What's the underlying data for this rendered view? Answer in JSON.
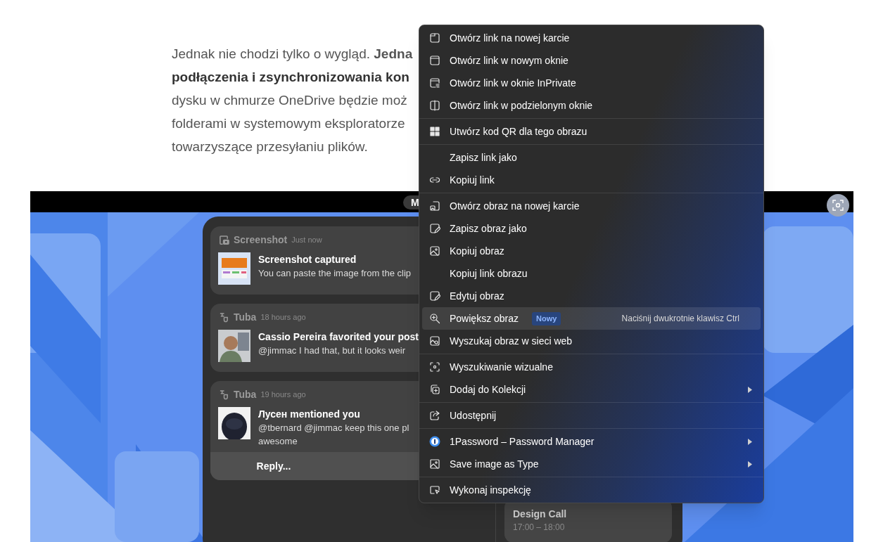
{
  "article": {
    "lines": [
      {
        "text": "Jednak nie chodzi tylko o wygląd. **Jedna**",
        "bold": false
      },
      {
        "text": "podłączenia i zsynchronizowania kon",
        "bold": true
      },
      {
        "text": "dysku w chmurze OneDrive będzie moż",
        "bold": false
      },
      {
        "text": "folderami w systemowym eksploratorze",
        "bold": false
      },
      {
        "text": "towarzyszące przesyłaniu plików.",
        "bold": false
      }
    ]
  },
  "screenshot": {
    "top_bar": {
      "pill": "M"
    },
    "notifications": [
      {
        "kind": "screenshot",
        "app": "Screenshot",
        "time": "Just now",
        "title": "Screenshot captured",
        "body_lines": [
          "You can paste the image from the clip"
        ]
      },
      {
        "kind": "tuba",
        "app": "Tuba",
        "time": "18 hours ago",
        "title": "Cassio Pereira favorited your post",
        "body_lines": [
          "@jimmac I had that, but it looks weir"
        ]
      },
      {
        "kind": "tuba",
        "app": "Tuba",
        "time": "19 hours ago",
        "title": "Лусен mentioned you",
        "body_lines": [
          "@tbernard @jimmac keep this one pl",
          "awesome"
        ],
        "action": "Reply..."
      }
    ],
    "event": {
      "title": "Design Call",
      "time": "17:00 – 18:00"
    }
  },
  "context_menu": {
    "groups": [
      {
        "items": [
          {
            "label": "Otwórz link na nowej karcie",
            "selected": false,
            "submenu": false
          },
          {
            "label": "Otwórz link w nowym oknie",
            "selected": false,
            "submenu": false
          },
          {
            "label": "Otwórz link w oknie InPrivate",
            "selected": false,
            "submenu": false
          },
          {
            "label": "Otwórz link w podzielonym oknie",
            "selected": false,
            "submenu": false
          }
        ]
      },
      {
        "items": [
          {
            "label": "Utwórz kod QR dla tego obrazu",
            "selected": false,
            "submenu": false
          }
        ]
      },
      {
        "items": [
          {
            "label": "Zapisz link jako",
            "selected": false,
            "submenu": false
          },
          {
            "label": "Kopiuj link",
            "selected": false,
            "submenu": false
          }
        ]
      },
      {
        "items": [
          {
            "label": "Otwórz obraz na nowej karcie",
            "selected": false,
            "submenu": false
          },
          {
            "label": "Zapisz obraz jako",
            "selected": false,
            "submenu": false
          },
          {
            "label": "Kopiuj obraz",
            "selected": false,
            "submenu": false
          },
          {
            "label": "Kopiuj link obrazu",
            "selected": false,
            "submenu": false
          },
          {
            "label": "Edytuj obraz",
            "selected": false,
            "submenu": false
          },
          {
            "label": "Powiększ obraz",
            "selected": true,
            "submenu": false,
            "badge": "Nowy",
            "shortcut": "Naciśnij dwukrotnie klawisz Ctrl"
          },
          {
            "label": "Wyszukaj obraz w sieci web",
            "selected": false,
            "submenu": false
          }
        ]
      },
      {
        "items": [
          {
            "label": "Wyszukiwanie wizualne",
            "selected": false,
            "submenu": false
          },
          {
            "label": "Dodaj do Kolekcji",
            "selected": false,
            "submenu": true
          }
        ]
      },
      {
        "items": [
          {
            "label": "Udostępnij",
            "selected": false,
            "submenu": false
          }
        ]
      },
      {
        "items": [
          {
            "label": "1Password – Password Manager",
            "selected": false,
            "submenu": true
          },
          {
            "label": "Save image as Type",
            "selected": false,
            "submenu": true
          }
        ]
      },
      {
        "items": [
          {
            "label": "Wykonaj inspekcję",
            "selected": false,
            "submenu": false
          }
        ]
      }
    ]
  }
}
